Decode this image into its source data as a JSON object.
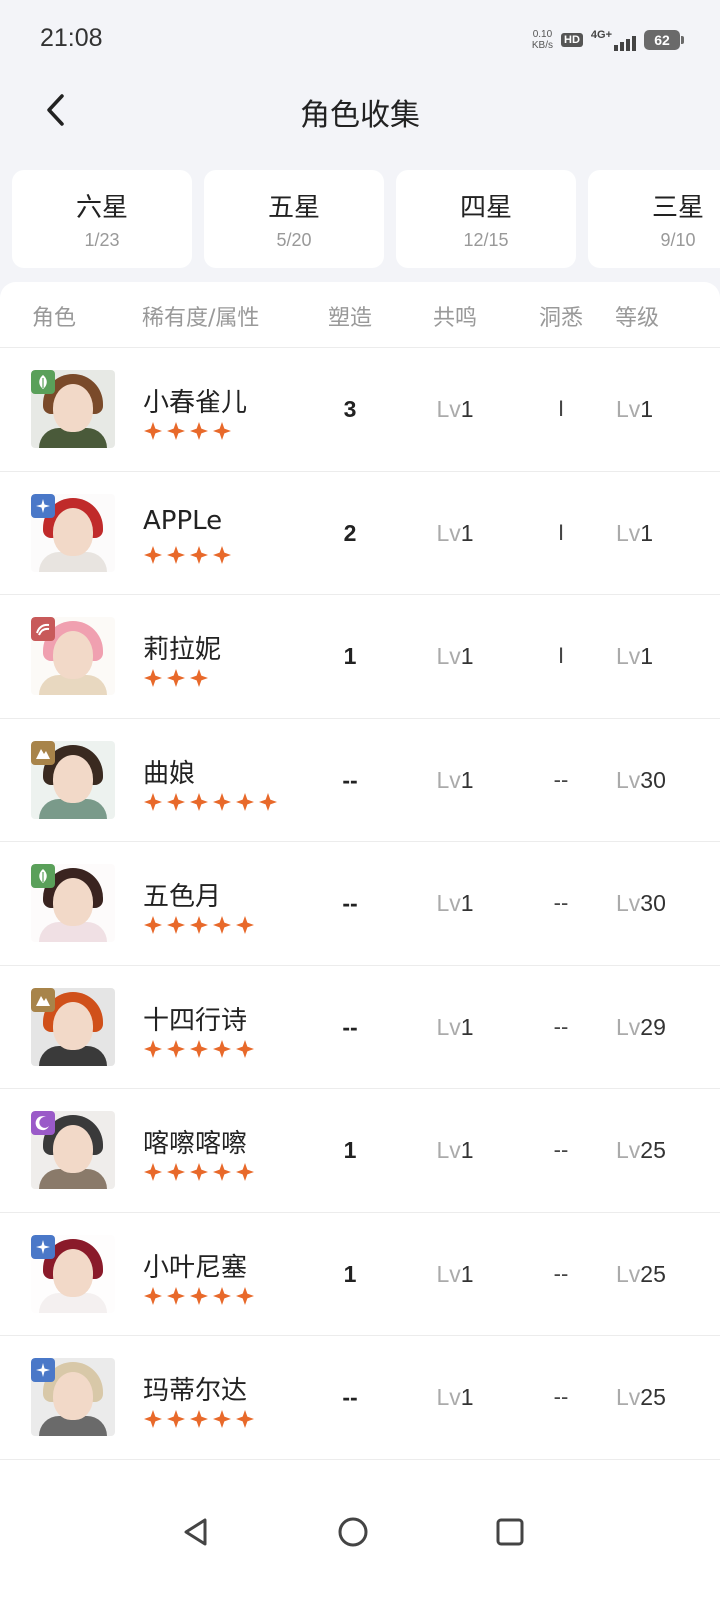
{
  "status_bar": {
    "time": "21:08",
    "net_speed_value": "0.10",
    "net_speed_unit": "KB/s",
    "hd": "HD",
    "network": "4G+",
    "battery": "62"
  },
  "header": {
    "title": "角色收集",
    "back_icon": "chevron-left-icon"
  },
  "tabs": [
    {
      "title": "六星",
      "count": "1/23"
    },
    {
      "title": "五星",
      "count": "5/20"
    },
    {
      "title": "四星",
      "count": "12/15"
    },
    {
      "title": "三星",
      "count": "9/10"
    }
  ],
  "table": {
    "columns": [
      "角色",
      "稀有度/属性",
      "塑造",
      "共鸣",
      "洞悉",
      "等级"
    ],
    "level_prefix": "Lv",
    "rows": [
      {
        "name": "小春雀儿",
        "stars": 4,
        "attribute": "leaf-icon",
        "attr_color": "#5aa05a",
        "shape": "3",
        "resonance": "1",
        "insight": "I",
        "level": "1",
        "hair": "#7a4a2a",
        "outfit": "#4a5a3a"
      },
      {
        "name": "APPLe",
        "stars": 4,
        "attribute": "star-spark-icon",
        "attr_color": "#4a78c8",
        "shape": "2",
        "resonance": "1",
        "insight": "I",
        "level": "1",
        "hair": "#c02a2a",
        "outfit": "#e8e4e0"
      },
      {
        "name": "莉拉妮",
        "stars": 3,
        "attribute": "wave-icon",
        "attr_color": "#c85a5a",
        "shape": "1",
        "resonance": "1",
        "insight": "I",
        "level": "1",
        "hair": "#f0a0b0",
        "outfit": "#e8d8c0"
      },
      {
        "name": "曲娘",
        "stars": 6,
        "attribute": "mountain-icon",
        "attr_color": "#a8844a",
        "shape": "--",
        "resonance": "1",
        "insight": "--",
        "level": "30",
        "hair": "#3a2a20",
        "outfit": "#7a9a8a"
      },
      {
        "name": "五色月",
        "stars": 5,
        "attribute": "leaf-icon",
        "attr_color": "#5aa05a",
        "shape": "--",
        "resonance": "1",
        "insight": "--",
        "level": "30",
        "hair": "#3a2420",
        "outfit": "#f0e0e4"
      },
      {
        "name": "十四行诗",
        "stars": 5,
        "attribute": "mountain-icon",
        "attr_color": "#a8844a",
        "shape": "--",
        "resonance": "1",
        "insight": "--",
        "level": "29",
        "hair": "#d0501a",
        "outfit": "#3a3a3a"
      },
      {
        "name": "喀嚓喀嚓",
        "stars": 5,
        "attribute": "moon-icon",
        "attr_color": "#9a5ac8",
        "shape": "1",
        "resonance": "1",
        "insight": "--",
        "level": "25",
        "hair": "#3a3a3a",
        "outfit": "#8a7a6a"
      },
      {
        "name": "小叶尼塞",
        "stars": 5,
        "attribute": "star-spark-icon",
        "attr_color": "#4a78c8",
        "shape": "1",
        "resonance": "1",
        "insight": "--",
        "level": "25",
        "hair": "#8a1a2a",
        "outfit": "#f4f0f0"
      },
      {
        "name": "玛蒂尔达",
        "stars": 5,
        "attribute": "star-spark-icon",
        "attr_color": "#4a78c8",
        "shape": "--",
        "resonance": "1",
        "insight": "--",
        "level": "25",
        "hair": "#d8c8a8",
        "outfit": "#6a6a6a"
      }
    ]
  },
  "colors": {
    "star": "#e8692a",
    "background": "#f3f4f8"
  },
  "nav": {
    "back": "nav-back-icon",
    "home": "nav-home-icon",
    "recents": "nav-recents-icon"
  }
}
